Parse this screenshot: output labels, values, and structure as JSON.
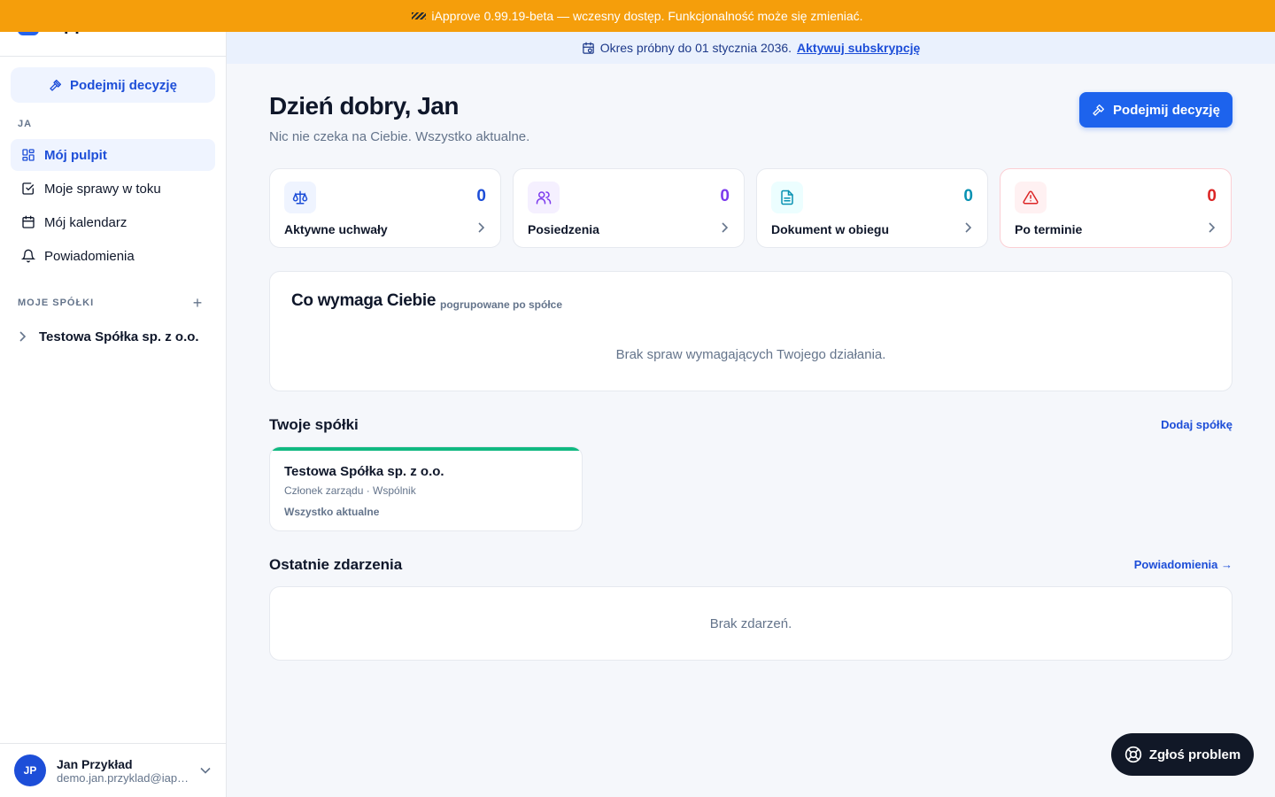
{
  "banner": {
    "text": "iApprove 0.99.19-beta — wczesny dostęp. Funkcjonalność może się zmieniać."
  },
  "brand": {
    "name": "iApprove"
  },
  "sidebar": {
    "cta_label": "Podejmij decyzję",
    "section_me": "JA",
    "items": [
      {
        "label": "Mój pulpit",
        "icon": "dashboard-icon",
        "active": true
      },
      {
        "label": "Moje sprawy w toku",
        "icon": "checkbox-icon",
        "active": false
      },
      {
        "label": "Mój kalendarz",
        "icon": "calendar-icon",
        "active": false
      },
      {
        "label": "Powiadomienia",
        "icon": "bell-icon",
        "active": false
      }
    ],
    "section_companies": "MOJE SPÓŁKI",
    "companies": [
      {
        "label": "Testowa Spółka sp. z o.o."
      }
    ]
  },
  "user": {
    "initials": "JP",
    "name": "Jan Przykład",
    "email": "demo.jan.przyklad@iapprove.pl"
  },
  "trial": {
    "text": "Okres próbny do 01 stycznia 2036.",
    "link": "Aktywuj subskrypcję"
  },
  "header": {
    "greeting": "Dzień dobry, Jan",
    "subtitle": "Nic nie czeka na Ciebie. Wszystko aktualne.",
    "cta_label": "Podejmij decyzję"
  },
  "stats": [
    {
      "label": "Aktywne uchwały",
      "value": "0",
      "icon": "scale-icon",
      "color": "#1d4ed8",
      "bg": "#eff4ff"
    },
    {
      "label": "Posiedzenia",
      "value": "0",
      "icon": "users-icon",
      "color": "#7c3aed",
      "bg": "#f5f0ff"
    },
    {
      "label": "Dokument w obiegu",
      "value": "0",
      "icon": "document-icon",
      "color": "#0891b2",
      "bg": "#ecfeff"
    },
    {
      "label": "Po terminie",
      "value": "0",
      "icon": "alert-icon",
      "color": "#dc2626",
      "bg": "#fff1f2"
    }
  ],
  "attention": {
    "title": "Co wymaga Ciebie",
    "subtitle": "pogrupowane po spółce",
    "empty": "Brak spraw wymagających Twojego działania."
  },
  "companies_section": {
    "title": "Twoje spółki",
    "link": "Dodaj spółkę",
    "cards": [
      {
        "name": "Testowa Spółka sp. z o.o.",
        "roles": "Członek zarządu · Wspólnik",
        "status": "Wszystko aktualne"
      }
    ]
  },
  "events": {
    "title": "Ostatnie zdarzenia",
    "link": "Powiadomienia →",
    "empty": "Brak zdarzeń."
  },
  "report": {
    "label": "Zgłoś problem"
  }
}
